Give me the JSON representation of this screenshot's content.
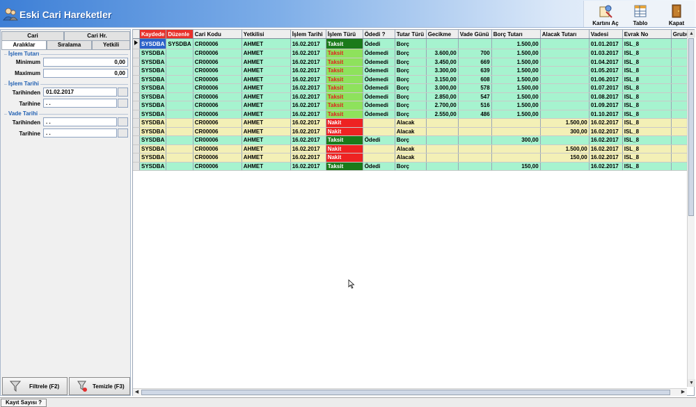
{
  "window": {
    "title": "Eski Cari Hareketler"
  },
  "toolbar": {
    "buttons": [
      {
        "label": "Kartını Aç",
        "icon": "open-card-icon"
      },
      {
        "label": "Tablo",
        "icon": "table-icon"
      },
      {
        "label": "Kapat",
        "icon": "close-door-icon"
      }
    ]
  },
  "left_panel": {
    "tabs_top": [
      "Cari",
      "Cari Hr."
    ],
    "tabs_bottom": [
      "Aralıklar",
      "Sıralama",
      "Yetkili"
    ],
    "groups": {
      "islem_tutari": {
        "title": "İşlem Tutarı",
        "min_label": "Minimum",
        "min_value": "0,00",
        "max_label": "Maximum",
        "max_value": "0,00"
      },
      "islem_tarihi": {
        "title": "İşlem Tarihi",
        "from_label": "Tarihinden",
        "from_value": "01.02.2017",
        "to_label": "Tarihine",
        "to_value": " .  ."
      },
      "vade_tarihi": {
        "title": "Vade Tarihi",
        "from_label": "Tarihinden",
        "from_value": " .  .",
        "to_label": "Tarihine",
        "to_value": " .  ."
      }
    },
    "filter_button": "Filtrele (F2)",
    "clear_button": "Temizle (F3)"
  },
  "grid": {
    "columns": [
      "Kaydede",
      "Düzenle",
      "Cari Kodu",
      "Yetkilisi",
      "İşlem Tarihi",
      "İşlem Türü",
      "Ödedi ?",
      "Tutar Türü",
      "Gecikme",
      "Vade Günü",
      "Borç Tutarı",
      "Alacak Tutarı",
      "Vadesi",
      "Evrak No",
      "Grubu"
    ],
    "rows": [
      {
        "k": "SYSDBA",
        "d": "SYSDBA",
        "cari": "CR00006",
        "yet": "AHMET",
        "tarih": "16.02.2017",
        "tur": "Taksit",
        "odedi": "Ödedi",
        "tutar": "Borç",
        "gec": "",
        "vgun": "",
        "borc": "1.500,00",
        "alacak": "",
        "vade": "01.01.2017",
        "evrak": "ISL_8",
        "grp": "",
        "color": "green",
        "turstyle": "taksit-dark",
        "selected": true
      },
      {
        "k": "SYSDBA",
        "d": "",
        "cari": "CR00006",
        "yet": "AHMET",
        "tarih": "16.02.2017",
        "tur": "Taksit",
        "odedi": "Ödemedi",
        "tutar": "Borç",
        "gec": "3.600,00",
        "vgun": "700",
        "borc": "1.500,00",
        "alacak": "",
        "vade": "01.03.2017",
        "evrak": "ISL_8",
        "grp": "",
        "color": "green",
        "turstyle": "taksit"
      },
      {
        "k": "SYSDBA",
        "d": "",
        "cari": "CR00006",
        "yet": "AHMET",
        "tarih": "16.02.2017",
        "tur": "Taksit",
        "odedi": "Ödemedi",
        "tutar": "Borç",
        "gec": "3.450,00",
        "vgun": "669",
        "borc": "1.500,00",
        "alacak": "",
        "vade": "01.04.2017",
        "evrak": "ISL_8",
        "grp": "",
        "color": "green",
        "turstyle": "taksit"
      },
      {
        "k": "SYSDBA",
        "d": "",
        "cari": "CR00006",
        "yet": "AHMET",
        "tarih": "16.02.2017",
        "tur": "Taksit",
        "odedi": "Ödemedi",
        "tutar": "Borç",
        "gec": "3.300,00",
        "vgun": "639",
        "borc": "1.500,00",
        "alacak": "",
        "vade": "01.05.2017",
        "evrak": "ISL_8",
        "grp": "",
        "color": "green",
        "turstyle": "taksit"
      },
      {
        "k": "SYSDBA",
        "d": "",
        "cari": "CR00006",
        "yet": "AHMET",
        "tarih": "16.02.2017",
        "tur": "Taksit",
        "odedi": "Ödemedi",
        "tutar": "Borç",
        "gec": "3.150,00",
        "vgun": "608",
        "borc": "1.500,00",
        "alacak": "",
        "vade": "01.06.2017",
        "evrak": "ISL_8",
        "grp": "",
        "color": "green",
        "turstyle": "taksit"
      },
      {
        "k": "SYSDBA",
        "d": "",
        "cari": "CR00006",
        "yet": "AHMET",
        "tarih": "16.02.2017",
        "tur": "Taksit",
        "odedi": "Ödemedi",
        "tutar": "Borç",
        "gec": "3.000,00",
        "vgun": "578",
        "borc": "1.500,00",
        "alacak": "",
        "vade": "01.07.2017",
        "evrak": "ISL_8",
        "grp": "",
        "color": "green",
        "turstyle": "taksit"
      },
      {
        "k": "SYSDBA",
        "d": "",
        "cari": "CR00006",
        "yet": "AHMET",
        "tarih": "16.02.2017",
        "tur": "Taksit",
        "odedi": "Ödemedi",
        "tutar": "Borç",
        "gec": "2.850,00",
        "vgun": "547",
        "borc": "1.500,00",
        "alacak": "",
        "vade": "01.08.2017",
        "evrak": "ISL_8",
        "grp": "",
        "color": "green",
        "turstyle": "taksit"
      },
      {
        "k": "SYSDBA",
        "d": "",
        "cari": "CR00006",
        "yet": "AHMET",
        "tarih": "16.02.2017",
        "tur": "Taksit",
        "odedi": "Ödemedi",
        "tutar": "Borç",
        "gec": "2.700,00",
        "vgun": "516",
        "borc": "1.500,00",
        "alacak": "",
        "vade": "01.09.2017",
        "evrak": "ISL_8",
        "grp": "",
        "color": "green",
        "turstyle": "taksit"
      },
      {
        "k": "SYSDBA",
        "d": "",
        "cari": "CR00006",
        "yet": "AHMET",
        "tarih": "16.02.2017",
        "tur": "Taksit",
        "odedi": "Ödemedi",
        "tutar": "Borç",
        "gec": "2.550,00",
        "vgun": "486",
        "borc": "1.500,00",
        "alacak": "",
        "vade": "01.10.2017",
        "evrak": "ISL_8",
        "grp": "",
        "color": "green",
        "turstyle": "taksit"
      },
      {
        "k": "SYSDBA",
        "d": "",
        "cari": "CR00006",
        "yet": "AHMET",
        "tarih": "16.02.2017",
        "tur": "Nakit",
        "odedi": "",
        "tutar": "Alacak",
        "gec": "",
        "vgun": "",
        "borc": "",
        "alacak": "1.500,00",
        "vade": "16.02.2017",
        "evrak": "ISL_8",
        "grp": "",
        "color": "yellow",
        "turstyle": "nakit"
      },
      {
        "k": "SYSDBA",
        "d": "",
        "cari": "CR00006",
        "yet": "AHMET",
        "tarih": "16.02.2017",
        "tur": "Nakit",
        "odedi": "",
        "tutar": "Alacak",
        "gec": "",
        "vgun": "",
        "borc": "",
        "alacak": "300,00",
        "vade": "16.02.2017",
        "evrak": "ISL_8",
        "grp": "",
        "color": "yellow",
        "turstyle": "nakit"
      },
      {
        "k": "SYSDBA",
        "d": "",
        "cari": "CR00006",
        "yet": "AHMET",
        "tarih": "16.02.2017",
        "tur": "Taksit",
        "odedi": "Ödedi",
        "tutar": "Borç",
        "gec": "",
        "vgun": "",
        "borc": "300,00",
        "alacak": "",
        "vade": "16.02.2017",
        "evrak": "ISL_8",
        "grp": "",
        "color": "green",
        "turstyle": "taksit-dark"
      },
      {
        "k": "SYSDBA",
        "d": "",
        "cari": "CR00006",
        "yet": "AHMET",
        "tarih": "16.02.2017",
        "tur": "Nakit",
        "odedi": "",
        "tutar": "Alacak",
        "gec": "",
        "vgun": "",
        "borc": "",
        "alacak": "1.500,00",
        "vade": "16.02.2017",
        "evrak": "ISL_8",
        "grp": "",
        "color": "yellow",
        "turstyle": "nakit"
      },
      {
        "k": "SYSDBA",
        "d": "",
        "cari": "CR00006",
        "yet": "AHMET",
        "tarih": "16.02.2017",
        "tur": "Nakit",
        "odedi": "",
        "tutar": "Alacak",
        "gec": "",
        "vgun": "",
        "borc": "",
        "alacak": "150,00",
        "vade": "16.02.2017",
        "evrak": "ISL_8",
        "grp": "",
        "color": "yellow",
        "turstyle": "nakit"
      },
      {
        "k": "SYSDBA",
        "d": "",
        "cari": "CR00006",
        "yet": "AHMET",
        "tarih": "16.02.2017",
        "tur": "Taksit",
        "odedi": "Ödedi",
        "tutar": "Borç",
        "gec": "",
        "vgun": "",
        "borc": "150,00",
        "alacak": "",
        "vade": "16.02.2017",
        "evrak": "ISL_8",
        "grp": "",
        "color": "green",
        "turstyle": "taksit-dark"
      }
    ]
  },
  "statusbar": {
    "label": "Kayıt Sayısı ?"
  }
}
